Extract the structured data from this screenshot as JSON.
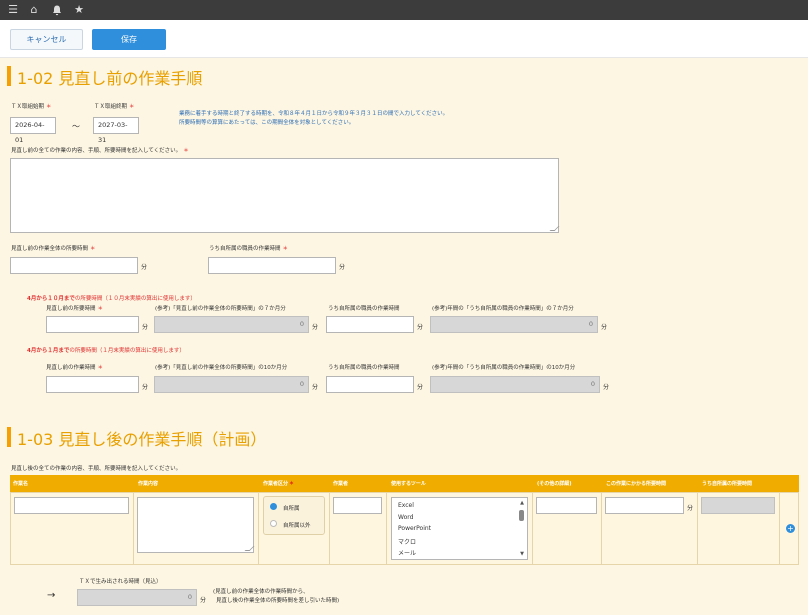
{
  "toolbar": {
    "icons": [
      "menu-icon",
      "home-icon",
      "bell-icon",
      "star-icon"
    ],
    "cancel_label": "キャンセル",
    "save_label": "保存"
  },
  "section1": {
    "title": "1-02 見直し前の作業手順",
    "start_label": "ＴＸ取組始期",
    "start_value": "2026-04-01",
    "tilde": "～",
    "end_label": "ＴＸ取組終期",
    "end_value": "2027-03-31",
    "note1": "業務に着手する時期と終了する時期を、令和８年４月１日から令和９年３月３１日の間で入力してください。",
    "note2": "所要時間等の算算にあたっては、この期間全体を対象としてください。",
    "desc_label": "見直し前の全ての作業の内容、手順、所要時間を記入してください。",
    "total_label": "見直し前の作業全体の所要時間",
    "own_label": "うち自所属の職員の作業時間",
    "unit": "分",
    "req": "＊",
    "p1": {
      "title_red": "4月から１０月まで",
      "title_rest": "の所要時間（１０月末実績の算出に使用します）",
      "c1": "見直し前の所要時間",
      "c2": "(参考)「見直し前の作業全体の所要時間」の７か月分",
      "c3": "うち自所属の職員の作業時間",
      "c4": "(参考)年間の「うち自所属の職員の作業時間」の７か月分",
      "ro1": "0",
      "ro2": "0"
    },
    "p2": {
      "title_red": "4月から１月まで",
      "title_rest": "の所要時間（１月末実績の算出に使用します）",
      "c1": "見直し前の作業時間",
      "c2": "(参考)「見直し前の作業全体の所要時間」の10か月分",
      "c3": "うち自所属の職員の作業時間",
      "c4": "(参考)年間の「うち自所属の職員の作業時間」の10か月分",
      "ro1": "0",
      "ro2": "0"
    }
  },
  "section2": {
    "title": "1-03 見直し後の作業手順（計画）",
    "desc_label": "見直し後の全ての作業の内容、手順、所要時間を記入してください。",
    "columns": [
      "作業名",
      "作業内容",
      "作業者区分",
      "作業者",
      "使用するツール",
      "(その他の詳細)",
      "この作業にかかる所要時間",
      "うち自所属の所要時間"
    ],
    "radio_options": [
      "自所属",
      "自所属以外"
    ],
    "tools": [
      "Excel",
      "Word",
      "PowerPoint",
      "マクロ",
      "メール"
    ],
    "unit": "分"
  },
  "result": {
    "label": "ＴＸで生み出される時間（見込）",
    "value": "0",
    "unit": "分",
    "arrow": "→",
    "note1": "(見直し前の作業全体の作業時間から、",
    "note2": "見直し後の作業全体の所要時間を差し引いた時間)"
  }
}
